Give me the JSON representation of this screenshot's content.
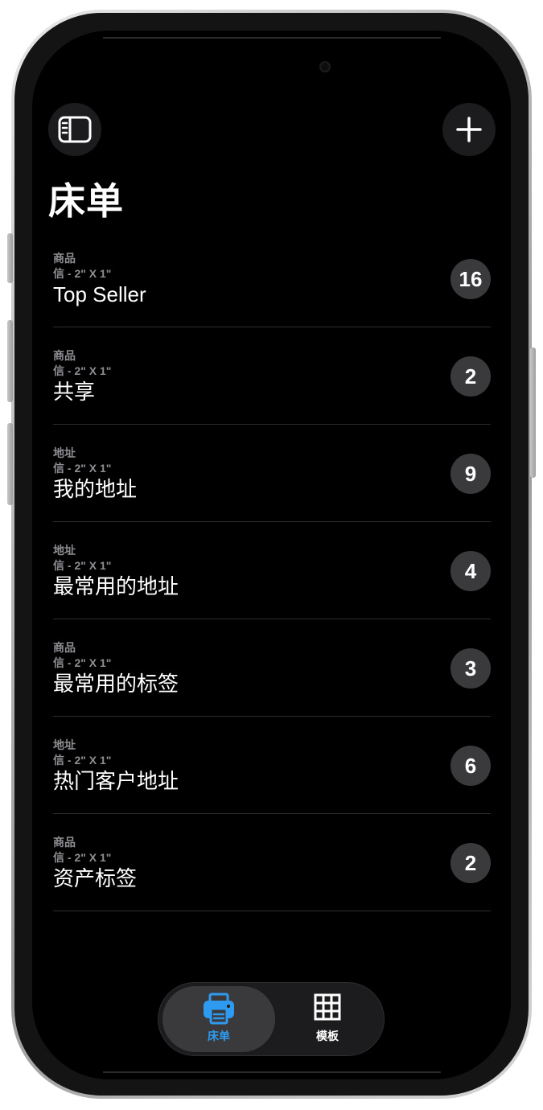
{
  "header": {
    "sidebar_icon": "sidebar-icon",
    "add_icon": "plus-icon",
    "title": "床单"
  },
  "rows": [
    {
      "category": "商品",
      "size": "信 - 2\" X 1\"",
      "title": "Top Seller",
      "count": "16"
    },
    {
      "category": "商品",
      "size": "信 - 2\" X 1\"",
      "title": "共享",
      "count": "2"
    },
    {
      "category": "地址",
      "size": "信 - 2\" X 1\"",
      "title": "我的地址",
      "count": "9"
    },
    {
      "category": "地址",
      "size": "信 - 2\" X 1\"",
      "title": "最常用的地址",
      "count": "4"
    },
    {
      "category": "商品",
      "size": "信 - 2\" X 1\"",
      "title": "最常用的标签",
      "count": "3"
    },
    {
      "category": "地址",
      "size": "信 - 2\" X 1\"",
      "title": "热门客户地址",
      "count": "6"
    },
    {
      "category": "商品",
      "size": "信 - 2\" X 1\"",
      "title": "资产标签",
      "count": "2"
    }
  ],
  "tabbar": {
    "tabs": [
      {
        "label": "床单",
        "icon": "printer-icon",
        "active": true
      },
      {
        "label": "模板",
        "icon": "grid-icon",
        "active": false
      }
    ]
  },
  "colors": {
    "background": "#000000",
    "accent": "#2f9bf0",
    "secondary_text": "#8e8e93",
    "badge": "#3a3a3c"
  }
}
